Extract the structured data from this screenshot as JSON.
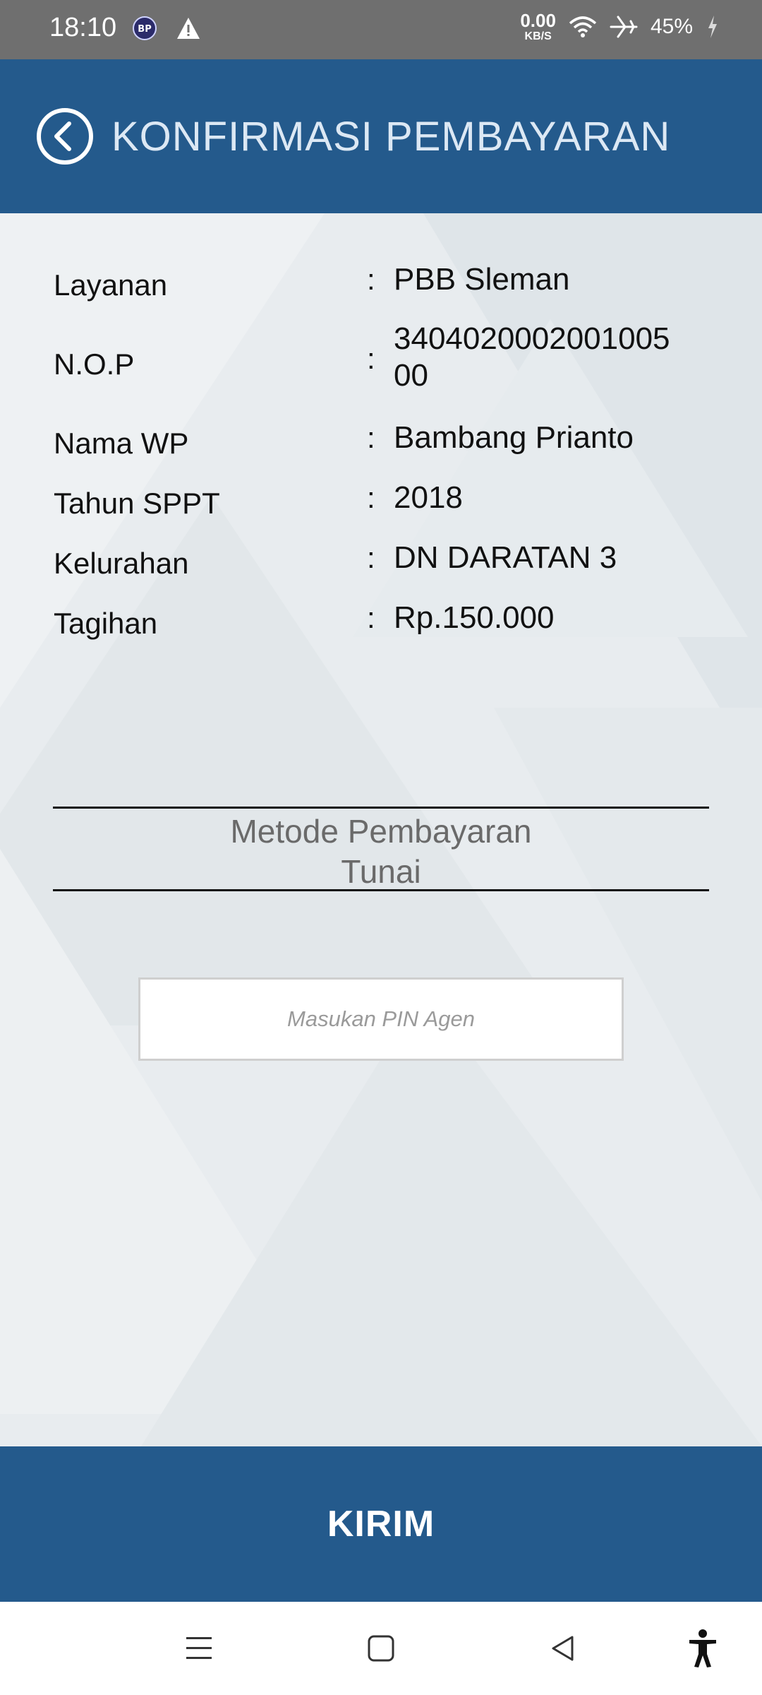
{
  "status_bar": {
    "time": "18:10",
    "net_speed_value": "0.00",
    "net_speed_unit": "KB/S",
    "battery": "45%",
    "icons": [
      "app-notification-icon",
      "warning-icon",
      "wifi-icon",
      "airplane-mode-icon",
      "charging-icon"
    ]
  },
  "header": {
    "title": "KONFIRMASI PEMBAYARAN",
    "back_icon": "back-arrow-circle-icon",
    "color": "#245a8c"
  },
  "details": [
    {
      "label": "Layanan",
      "value": "PBB Sleman"
    },
    {
      "label": "N.O.P",
      "value": "340402000200100500"
    },
    {
      "label": "Nama WP",
      "value": "Bambang Prianto"
    },
    {
      "label": "Tahun SPPT",
      "value": "2018"
    },
    {
      "label": "Kelurahan",
      "value": "DN DARATAN 3"
    },
    {
      "label": "Tagihan",
      "value": "Rp.150.000"
    }
  ],
  "separator": ":",
  "payment_method": {
    "title": "Metode Pembayaran",
    "value": "Tunai"
  },
  "pin": {
    "placeholder": "Masukan PIN Agen",
    "value": ""
  },
  "submit": {
    "label": "KIRIM"
  },
  "nav_bar": {
    "icons": [
      "menu-icon",
      "home-square-icon",
      "back-triangle-icon",
      "accessibility-icon"
    ]
  }
}
